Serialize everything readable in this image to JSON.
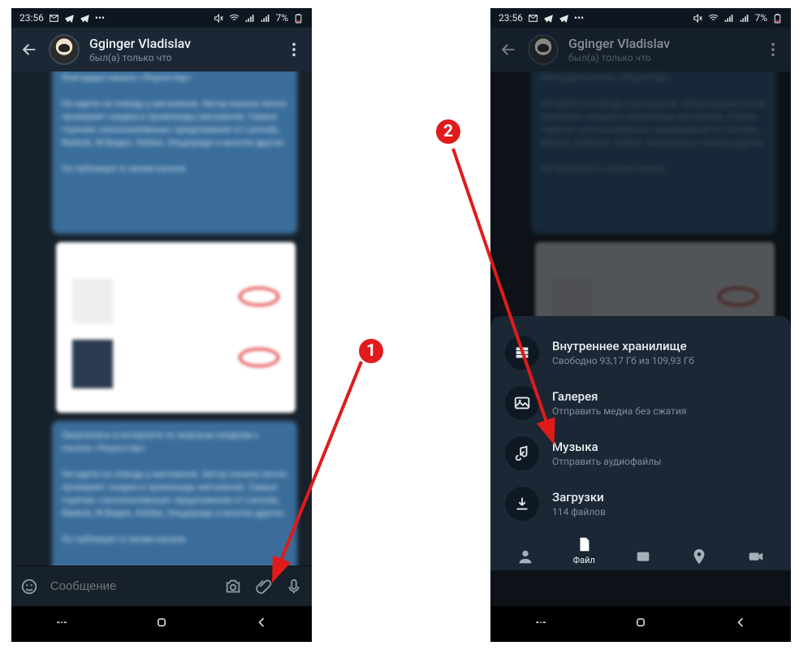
{
  "status": {
    "time": "23:56",
    "battery": "7%"
  },
  "chat": {
    "name": "Gginger Vladislav",
    "sub": "был(а) только что",
    "input_placeholder": "Сообщение"
  },
  "sheet": {
    "items": [
      {
        "title": "Внутреннее хранилище",
        "sub": "Свободно 93,17 Гб из 109,93 Гб",
        "icon": "storage"
      },
      {
        "title": "Галерея",
        "sub": "Отправить медиа без сжатия",
        "icon": "image"
      },
      {
        "title": "Музыка",
        "sub": "Отправить аудиофайлы",
        "icon": "music"
      },
      {
        "title": "Загрузки",
        "sub": "114 файлов",
        "icon": "download"
      }
    ],
    "tabs": {
      "file": "Файл"
    }
  },
  "annotations": {
    "one": "1",
    "two": "2"
  }
}
